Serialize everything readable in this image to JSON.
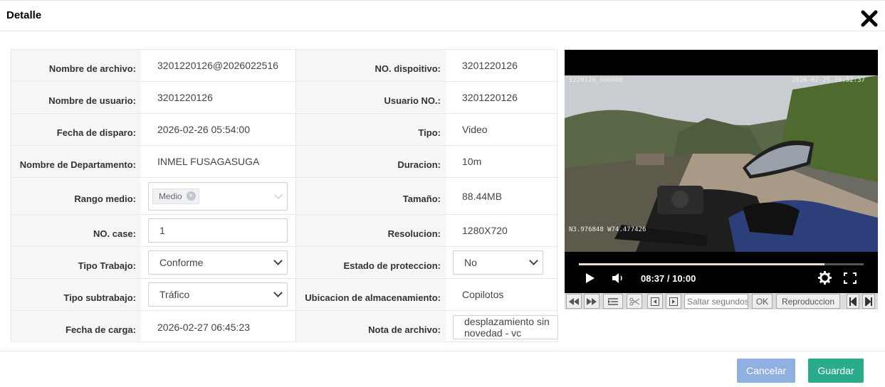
{
  "dialog": {
    "title": "Detalle"
  },
  "fields": {
    "nombre_archivo": {
      "label": "Nombre de archivo:",
      "value": "3201220126@2026022516"
    },
    "no_dispositivo": {
      "label": "NO. dispoitivo:",
      "value": "3201220126"
    },
    "nombre_usuario": {
      "label": "Nombre de usuario:",
      "value": "3201220126"
    },
    "usuario_no": {
      "label": "Usuario NO.:",
      "value": "3201220126"
    },
    "fecha_disparo": {
      "label": "Fecha de disparo:",
      "value": "2026-02-26 05:54:00"
    },
    "tipo": {
      "label": "Tipo:",
      "value": "Video"
    },
    "departamento": {
      "label": "Nombre de Departamento:",
      "value": "INMEL FUSAGASUGA"
    },
    "duracion": {
      "label": "Duracion:",
      "value": "10m"
    },
    "rango_medio": {
      "label": "Rango medio:",
      "tag": "Medio",
      "tag_remove": "×"
    },
    "tamano": {
      "label": "Tamaño:",
      "value": "88.44MB"
    },
    "no_case": {
      "label": "NO. case:",
      "value": "1"
    },
    "resolucion": {
      "label": "Resolucion:",
      "value": "1280X720"
    },
    "tipo_trabajo": {
      "label": "Tipo Trabajo:",
      "value": "Conforme"
    },
    "estado_proteccion": {
      "label": "Estado de proteccion:",
      "value": "No"
    },
    "tipo_subtrabajo": {
      "label": "Tipo subtrabajo:",
      "value": "Tráfico"
    },
    "ubicacion": {
      "label": "Ubicacion de almacenamiento:",
      "value": "Copilotos"
    },
    "fecha_carga": {
      "label": "Fecha de carga:",
      "value": "2026-02-27 06:45:23"
    },
    "nota_archivo": {
      "label": "Nota de archivo:",
      "value": "desplazamiento sin novedad - vc"
    }
  },
  "video": {
    "overlay_id": "1220126_000000",
    "overlay_datetime": "2026-02-25 16:52:37",
    "overlay_gps": "N3.976848 W74.477426",
    "time_display": "08:37 / 10:00",
    "progress": 0.862
  },
  "toolbar": {
    "skip_placeholder": "Saltar segundos",
    "ok_label": "OK",
    "playback_label": "Reproduccion"
  },
  "footer": {
    "cancel_label": "Cancelar",
    "save_label": "Guardar"
  },
  "colors": {
    "cancel": "#8fb0e0",
    "save": "#2aab8c",
    "label_bg": "#f5f6f7"
  },
  "icons": [
    "close-icon",
    "play-icon",
    "volume-icon",
    "settings-icon",
    "fullscreen-icon",
    "rewind-icon",
    "fast-forward-icon",
    "list-icon",
    "scissors-icon",
    "prev-frame-icon",
    "next-frame-icon",
    "skip-start-icon",
    "skip-end-icon"
  ]
}
